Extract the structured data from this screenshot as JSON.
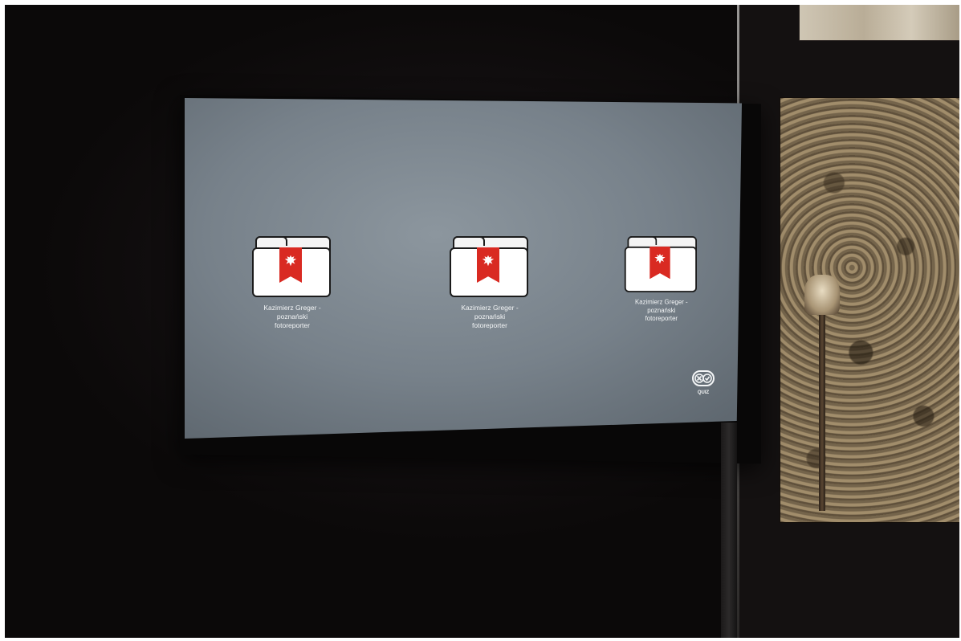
{
  "screen": {
    "folders": [
      {
        "line1": "Kazimierz Greger -",
        "line2": "poznański",
        "line3": "fotoreporter",
        "icon": "folder-eagle-icon"
      },
      {
        "line1": "Kazimierz Greger -",
        "line2": "poznański",
        "line3": "fotoreporter",
        "icon": "folder-eagle-icon"
      },
      {
        "line1": "Kazimierz Greger -",
        "line2": "poznański",
        "line3": "fotoreporter",
        "icon": "folder-eagle-icon"
      }
    ],
    "quiz": {
      "label": "QUIZ",
      "icon": "quiz-icon"
    }
  },
  "colors": {
    "screen_bg": "#7f8991",
    "ribbon": "#d92a22",
    "folder": "#ffffff",
    "text": "#f3f5f6"
  }
}
